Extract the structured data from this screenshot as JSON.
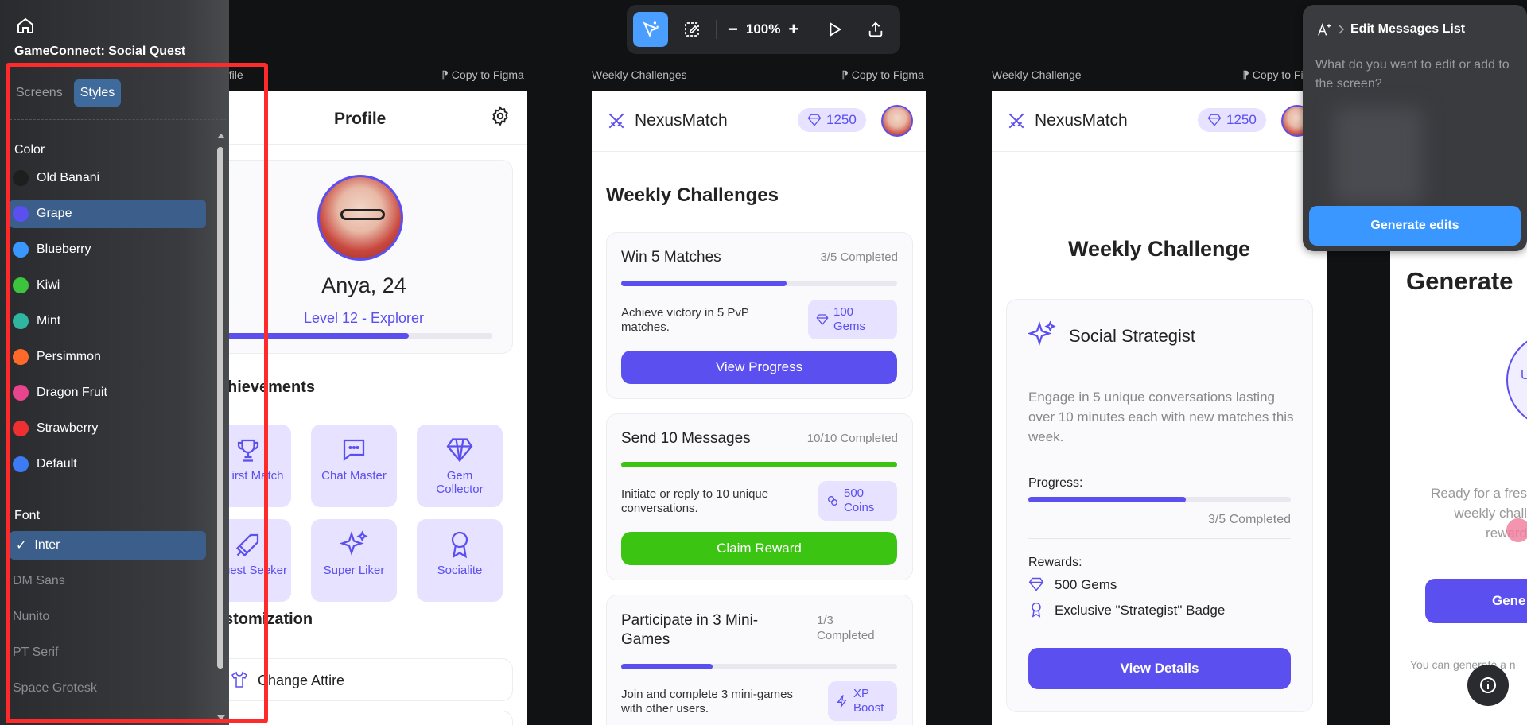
{
  "project": {
    "title": "GameConnect: Social Quest"
  },
  "sidebar": {
    "tabs": [
      "Screens",
      "Styles"
    ],
    "color_section": "Color",
    "colors": [
      {
        "name": "Old Banani",
        "hex": "#1e1e1e"
      },
      {
        "name": "Grape",
        "hex": "#5b4ff0"
      },
      {
        "name": "Blueberry",
        "hex": "#3a97ff"
      },
      {
        "name": "Kiwi",
        "hex": "#3cc43c"
      },
      {
        "name": "Mint",
        "hex": "#2fb5a0"
      },
      {
        "name": "Persimmon",
        "hex": "#ff6a2a"
      },
      {
        "name": "Dragon Fruit",
        "hex": "#e8458e"
      },
      {
        "name": "Strawberry",
        "hex": "#f03030"
      },
      {
        "name": "Default",
        "hex": "#3d7bf5"
      }
    ],
    "selected_color": "Grape",
    "font_section": "Font",
    "fonts": [
      "Inter",
      "DM Sans",
      "Nunito",
      "PT Serif",
      "Space Grotesk"
    ],
    "selected_font": "Inter"
  },
  "toolbar": {
    "zoom": "100%"
  },
  "frames": [
    {
      "label": "Profile",
      "label_visible": "ofile",
      "copy": "Copy to Figma"
    },
    {
      "label": "Weekly Challenges",
      "copy": "Copy to Figma"
    },
    {
      "label": "Weekly Challenge",
      "copy": "Copy to Fig"
    }
  ],
  "profile": {
    "title": "Profile",
    "name": "Anya, 24",
    "level": "Level 12 - Explorer",
    "level_progress": 0.7,
    "achievements_title": "hievements",
    "achievements": [
      "irst Match",
      "Chat Master",
      "Gem Collector",
      "uest Seeker",
      "Super Liker",
      "Socialite"
    ],
    "customization_title": "stomization",
    "attire": "Change Attire"
  },
  "challenges": {
    "brand": "NexusMatch",
    "gems": "1250",
    "title": "Weekly Challenges",
    "items": [
      {
        "title": "Win 5 Matches",
        "status": "3/5 Completed",
        "progress": 0.6,
        "desc": "Achieve victory in 5 PvP matches.",
        "reward_line1": "100",
        "reward_line2": "Gems",
        "button": "View Progress"
      },
      {
        "title": "Send 10 Messages",
        "status": "10/10 Completed",
        "progress": 1.0,
        "desc": "Initiate or reply to 10 unique conversations.",
        "reward_line1": "500",
        "reward_line2": "Coins",
        "button": "Claim Reward"
      },
      {
        "title": "Participate in 3 Mini-Games",
        "status_line1": "1/3",
        "status_line2": "Completed",
        "progress": 0.33,
        "desc": "Join and complete 3 mini-games with other users.",
        "reward_line1": "XP",
        "reward_line2": "Boost"
      }
    ]
  },
  "challenge_detail": {
    "brand": "NexusMatch",
    "gems": "1250",
    "title": "Weekly Challenge",
    "card_title": "Social Strategist",
    "desc": "Engage in 5 unique conversations lasting over 10 minutes each with new matches this week.",
    "progress_label": "Progress:",
    "progress": 0.6,
    "status": "3/5 Completed",
    "rewards_label": "Rewards:",
    "reward1": "500 Gems",
    "reward2": "Exclusive \"Strategist\" Badge",
    "button": "View Details"
  },
  "partial_screen": {
    "title": "Generate",
    "line1": "Ready for a fres",
    "line2": "weekly chall",
    "line3": "reward",
    "button": "Gene",
    "footer": "You can generate a n",
    "circle_text": "U"
  },
  "edit_panel": {
    "breadcrumb": "Edit Messages List",
    "placeholder": "What do you want to edit or add to the screen?",
    "button": "Generate edits"
  }
}
